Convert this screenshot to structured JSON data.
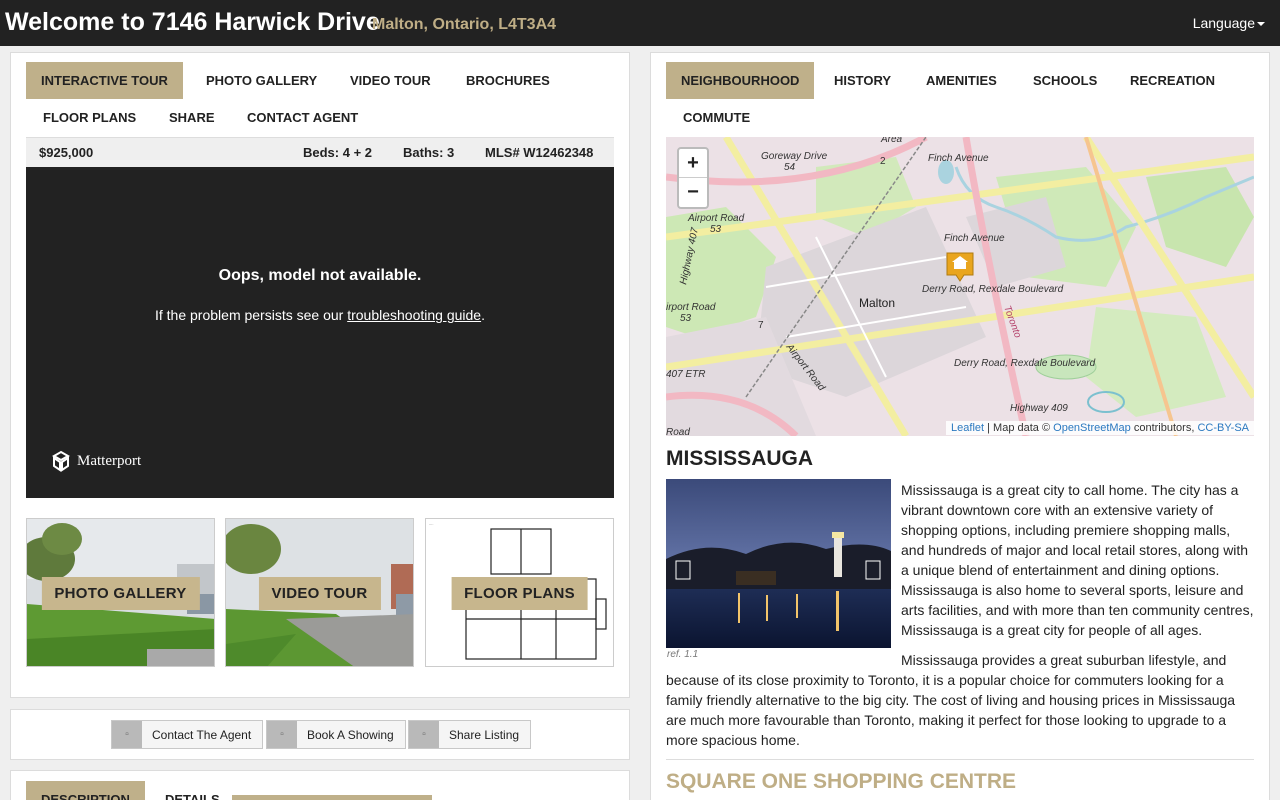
{
  "header": {
    "title": "Welcome to 7146 Harwick Drive",
    "subtitle": "Malton, Ontario, L4T3A4",
    "language_label": "Language"
  },
  "left_tabs": [
    {
      "label": "INTERACTIVE TOUR",
      "active": true
    },
    {
      "label": "PHOTO GALLERY",
      "active": false
    },
    {
      "label": "VIDEO TOUR",
      "active": false
    },
    {
      "label": "BROCHURES",
      "active": false
    },
    {
      "label": "FLOOR PLANS",
      "active": false
    },
    {
      "label": "SHARE",
      "active": false
    },
    {
      "label": "CONTACT AGENT",
      "active": false
    }
  ],
  "listing": {
    "price": "$925,000",
    "beds": "Beds: 4 + 2",
    "baths": "Baths: 3",
    "mls": "MLS# W12462348"
  },
  "viewer": {
    "error_title": "Oops, model not available.",
    "persist_prefix": "If the problem persists see our ",
    "guide_link": "troubleshooting guide",
    "persist_suffix": ".",
    "logo_text": "Matterport"
  },
  "thumbnails": [
    {
      "label": "PHOTO GALLERY"
    },
    {
      "label": "VIDEO TOUR"
    },
    {
      "label": "FLOOR PLANS"
    }
  ],
  "actions": [
    {
      "label": "Contact The Agent",
      "icon": "envelope-icon"
    },
    {
      "label": "Book A Showing",
      "icon": "calendar-icon"
    },
    {
      "label": "Share Listing",
      "icon": "share-icon"
    }
  ],
  "lower_tabs": [
    {
      "label": "DESCRIPTION",
      "active": true
    },
    {
      "label": "DETAILS",
      "active": false
    }
  ],
  "right_tabs": [
    {
      "label": "NEIGHBOURHOOD",
      "active": true
    },
    {
      "label": "HISTORY",
      "active": false
    },
    {
      "label": "AMENITIES",
      "active": false
    },
    {
      "label": "SCHOOLS",
      "active": false
    },
    {
      "label": "RECREATION",
      "active": false
    },
    {
      "label": "COMMUTE",
      "active": false
    }
  ],
  "map": {
    "zoom_in": "+",
    "zoom_out": "−",
    "labels": {
      "goreway": "Goreway Drive",
      "r54": "54",
      "r2": "2",
      "finch1": "Finch Avenue",
      "area": "Area",
      "airport53": "Airport Road",
      "r53": "53",
      "hw407a": "Highway 407",
      "finch2": "Finch Avenue",
      "derry1": "Derry Road, Rexdale Boulevard",
      "malton": "Malton",
      "airportrd": "irport Road",
      "r53b": "53",
      "r7": "7",
      "airportrd2": "Airport Road",
      "toronto": "Toronto",
      "etr": "407 ETR",
      "derry2": "Derry Road, Rexdale Boulevard",
      "hw409": "Highway 409",
      "road": "Road"
    },
    "attribution": {
      "leaflet": "Leaflet",
      "sep1": " | Map data © ",
      "osm": "OpenStreetMap",
      "sep2": " contributors, ",
      "license": "CC-BY-SA"
    }
  },
  "neighbourhood": {
    "city": "MISSISSAUGA",
    "image_ref": "ref. 1.1",
    "para1": "Mississauga is a great city to call home. The city has a vibrant downtown core with an extensive variety of shopping options, including premiere shopping malls, and hundreds of major and local retail stores, along with a unique blend of entertainment and dining options. Mississauga is also home to several sports, leisure and arts facilities, and with more than ten community centres, Mississauga is a great city for people of all ages.",
    "para2": "Mississauga provides a great suburban lifestyle, and because of its close proximity to Toronto, it is a popular choice for commuters looking for a family friendly alternative to the big city. The cost of living and housing prices in Mississauga are much more favourable than Toronto, making it perfect for those looking to upgrade to a more spacious home.",
    "next_heading": "SQUARE ONE SHOPPING CENTRE"
  },
  "colors": {
    "accent": "#bfb08a",
    "header_bg": "#222222",
    "gold_text": "#bfae86"
  }
}
